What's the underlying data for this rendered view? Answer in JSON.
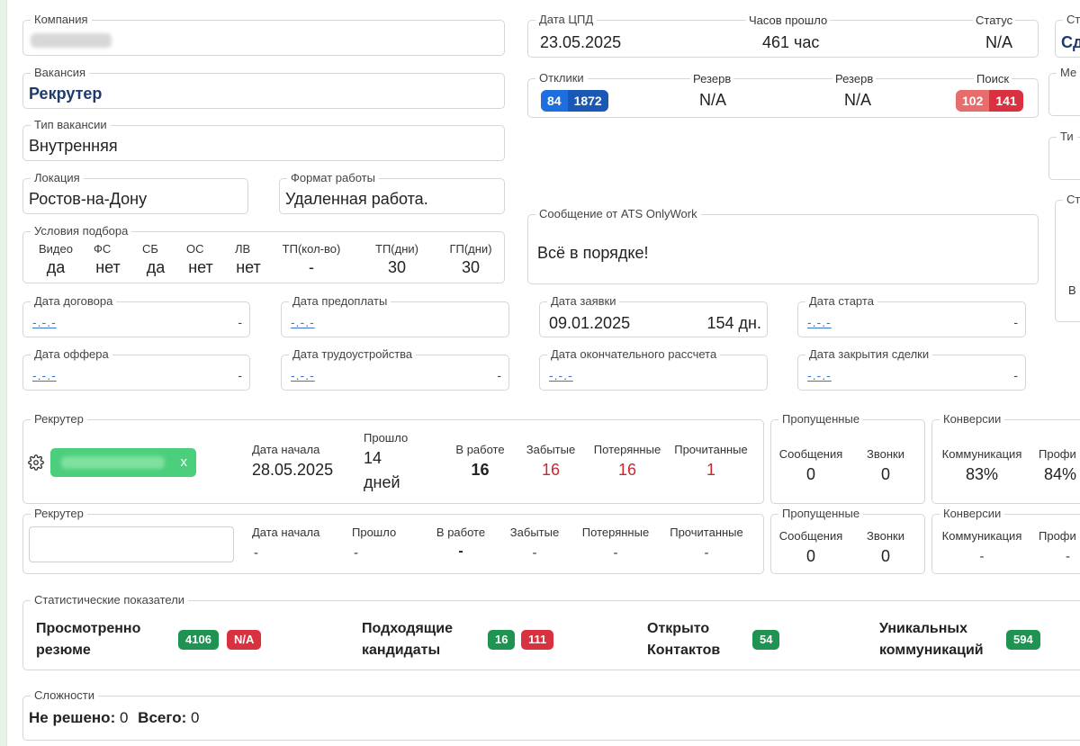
{
  "company": {
    "label": "Компания"
  },
  "vacancy": {
    "label": "Вакансия",
    "value": "Рекрутер"
  },
  "vacancy_type": {
    "label": "Тип вакансии",
    "value": "Внутренняя"
  },
  "location": {
    "label": "Локация",
    "value": "Ростов-на-Дону"
  },
  "work_format": {
    "label": "Формат работы",
    "value": "Удаленная работа."
  },
  "conditions": {
    "label": "Условия подбора",
    "cols": [
      {
        "h": "Видео",
        "v": "да"
      },
      {
        "h": "ФС",
        "v": "нет"
      },
      {
        "h": "СБ",
        "v": "да"
      },
      {
        "h": "ОС",
        "v": "нет"
      },
      {
        "h": "ЛВ",
        "v": "нет"
      },
      {
        "h": "ТП(кол-во)",
        "v": "-"
      },
      {
        "h": "ТП(дни)",
        "v": "30"
      },
      {
        "h": "ГП(дни)",
        "v": "30"
      }
    ]
  },
  "top_right": {
    "cpd_label": "Дата ЦПД",
    "cpd_value": "23.05.2025",
    "hours_label": "Часов прошло",
    "hours_value": "461 час",
    "status_label": "Статус",
    "status_value": "N/A",
    "side_status_label": "Ст",
    "side_status_value": "Сд"
  },
  "responses": {
    "otkliki_label": "Отклики",
    "otkliki_a": "84",
    "otkliki_b": "1872",
    "reserve1_label": "Резерв",
    "reserve1_value": "N/A",
    "reserve2_label": "Резерв",
    "reserve2_value": "N/A",
    "search_label": "Поиск",
    "search_a": "102",
    "search_b": "141",
    "side_label": "Ме"
  },
  "side": {
    "ti_label": "Ти",
    "st_label": "Ст",
    "v_label": "В"
  },
  "ats": {
    "label": "Сообщение от ATS OnlyWork",
    "message": "Всё в порядке!"
  },
  "dates": {
    "contract_label": "Дата договора",
    "contract_value": "-.-.-",
    "prepay_label": "Дата предоплаты",
    "prepay_value": "-.-.-",
    "request_label": "Дата заявки",
    "request_value": "09.01.2025",
    "request_days": "154 дн.",
    "start_label": "Дата старта",
    "start_value": "-.-.-",
    "offer_label": "Дата оффера",
    "offer_value": "-.-.-",
    "employment_label": "Дата трудоустройства",
    "employment_value": "-.-.-",
    "final_label": "Дата окончательного рассчета",
    "final_value": "-.-.-",
    "close_label": "Дата закрытия сделки",
    "close_value": "-.-.-",
    "dash": "-"
  },
  "recruiter1": {
    "label": "Рекрутер",
    "chip_close": "x",
    "start_label": "Дата начала",
    "start_value": "28.05.2025",
    "passed_label": "Прошло",
    "passed_value": "14",
    "passed_unit": "дней",
    "work_label": "В работе",
    "work_value": "16",
    "forgot_label": "Забытые",
    "forgot_value": "16",
    "lost_label": "Потерянные",
    "lost_value": "16",
    "read_label": "Прочитанные",
    "read_value": "1"
  },
  "missed1": {
    "label": "Пропущенные",
    "msg_label": "Сообщения",
    "msg_value": "0",
    "calls_label": "Звонки",
    "calls_value": "0"
  },
  "conv1": {
    "label": "Конверсии",
    "comm_label": "Коммуникация",
    "comm_value": "83%",
    "prof_label": "Профи",
    "prof_value": "84%"
  },
  "recruiter2": {
    "label": "Рекрутер",
    "start_label": "Дата начала",
    "start_value": "-",
    "passed_label": "Прошло",
    "passed_value": "-",
    "work_label": "В работе",
    "work_value": "-",
    "forgot_label": "Забытые",
    "forgot_value": "-",
    "lost_label": "Потерянные",
    "lost_value": "-",
    "read_label": "Прочитанные",
    "read_value": "-"
  },
  "missed2": {
    "label": "Пропущенные",
    "msg_label": "Сообщения",
    "msg_value": "0",
    "calls_label": "Звонки",
    "calls_value": "0"
  },
  "conv2": {
    "label": "Конверсии",
    "comm_label": "Коммуникация",
    "comm_value": "-",
    "prof_label": "Профи",
    "prof_value": "-"
  },
  "stats": {
    "label": "Статистические показатели",
    "viewed_l1": "Просмотренно",
    "viewed_l2": "резюме",
    "viewed_a": "4106",
    "viewed_b": "N/A",
    "suitable_l1": "Подходящие",
    "suitable_l2": "кандидаты",
    "suitable_a": "16",
    "suitable_b": "111",
    "opened_l1": "Открыто",
    "opened_l2": "Контактов",
    "opened_a": "54",
    "unique_l1": "Уникальных",
    "unique_l2": "коммуникаций",
    "unique_a": "594"
  },
  "difficulties": {
    "label": "Сложности",
    "unsolved_label": "Не решено:",
    "unsolved_value": "0",
    "total_label": "Всего:",
    "total_value": "0"
  },
  "colors": {
    "green": "#1f9452",
    "red": "#d9313f",
    "blue": "#1d6fe0",
    "navy": "#1f3b6e"
  }
}
